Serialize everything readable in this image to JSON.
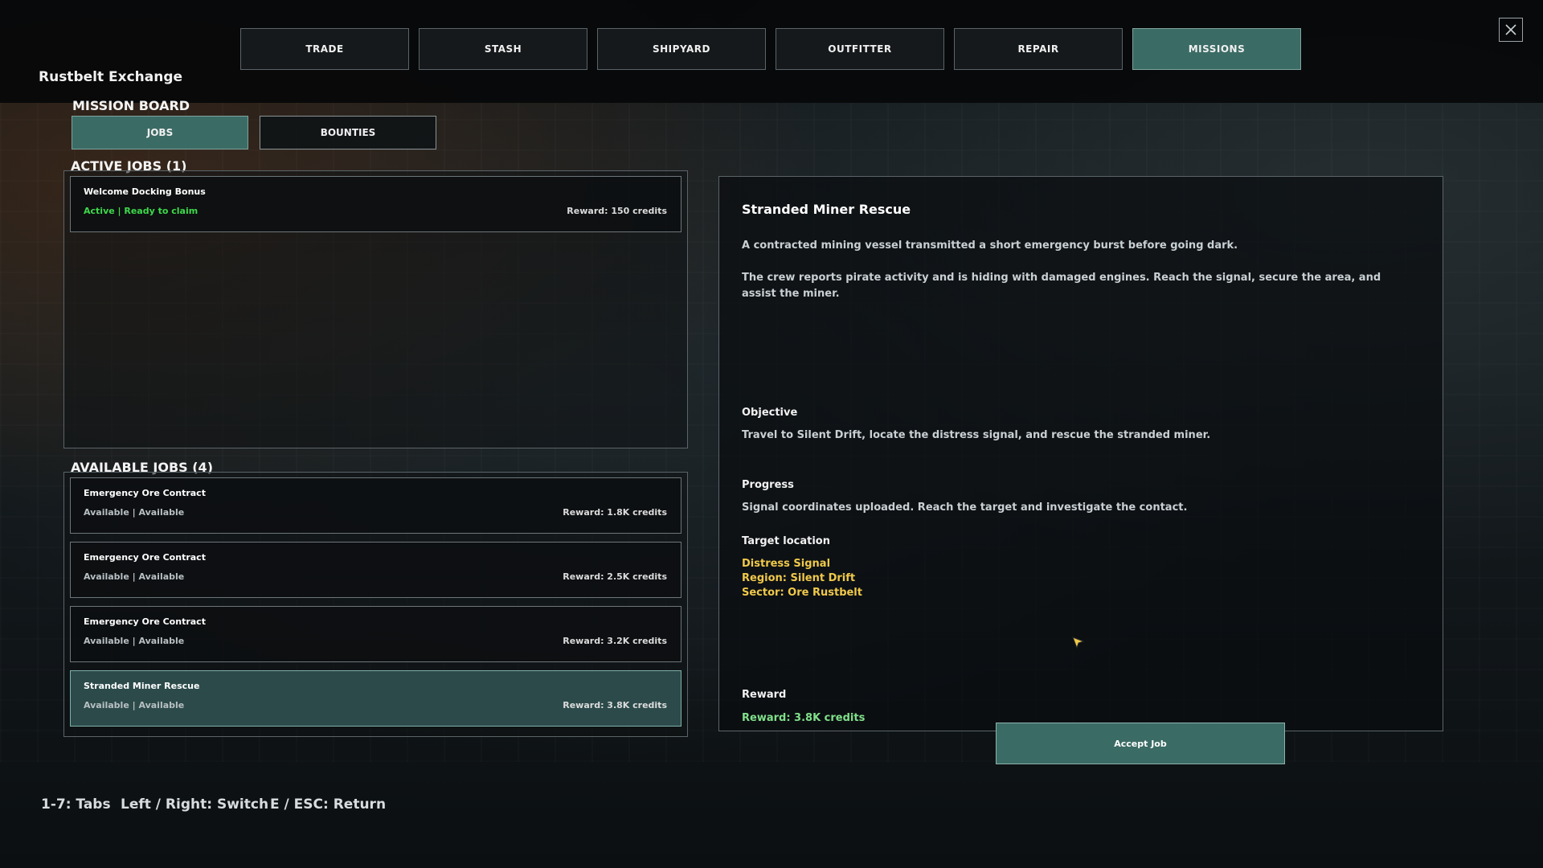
{
  "station": {
    "name": "Rustbelt Exchange"
  },
  "tabs": [
    {
      "label": "TRADE",
      "active": false
    },
    {
      "label": "STASH",
      "active": false
    },
    {
      "label": "SHIPYARD",
      "active": false
    },
    {
      "label": "OUTFITTER",
      "active": false
    },
    {
      "label": "REPAIR",
      "active": false
    },
    {
      "label": "MISSIONS",
      "active": true
    }
  ],
  "mission_board": {
    "heading": "MISSION BOARD",
    "subtabs": [
      {
        "label": "JOBS",
        "active": true
      },
      {
        "label": "BOUNTIES",
        "active": false
      }
    ]
  },
  "active_jobs": {
    "heading": "ACTIVE JOBS (1)",
    "items": [
      {
        "title": "Welcome Docking Bonus",
        "status": "Active | Ready to claim",
        "reward": "Reward: 150 credits"
      }
    ]
  },
  "available_jobs": {
    "heading": "AVAILABLE JOBS (4)",
    "items": [
      {
        "title": "Emergency Ore Contract",
        "status": "Available | Available",
        "reward": "Reward: 1.8K credits"
      },
      {
        "title": "Emergency Ore Contract",
        "status": "Available | Available",
        "reward": "Reward: 2.5K credits"
      },
      {
        "title": "Emergency Ore Contract",
        "status": "Available | Available",
        "reward": "Reward: 3.2K credits"
      },
      {
        "title": "Stranded Miner Rescue",
        "status": "Available | Available",
        "reward": "Reward: 3.8K credits",
        "selected": true
      }
    ]
  },
  "detail": {
    "title": "Stranded Miner Rescue",
    "description_1": "A contracted mining vessel transmitted a short emergency burst before going dark.",
    "description_2": "The crew reports pirate activity and is hiding with damaged engines. Reach the signal, secure the area, and assist the miner.",
    "objective_label": "Objective",
    "objective_text": "Travel to Silent Drift, locate the distress signal, and rescue the stranded miner.",
    "progress_label": "Progress",
    "progress_text": "Signal coordinates uploaded. Reach the target and investigate the contact.",
    "target_label": "Target location",
    "target_lines": [
      "Distress Signal",
      "Region: Silent Drift",
      "Sector: Ore Rustbelt"
    ],
    "reward_label": "Reward",
    "reward_text": "Reward: 3.8K credits",
    "accept_label": "Accept Job"
  },
  "hints": [
    "1-7: Tabs",
    "Left / Right: Switch",
    "E / ESC: Return"
  ],
  "colors": {
    "accent": "#3b6b65",
    "ready_green": "#3dd94a",
    "target_yellow": "#f0c94a",
    "reward_green": "#7fe08a"
  },
  "icons": {
    "close": "close-icon",
    "cursor": "cursor-icon"
  }
}
